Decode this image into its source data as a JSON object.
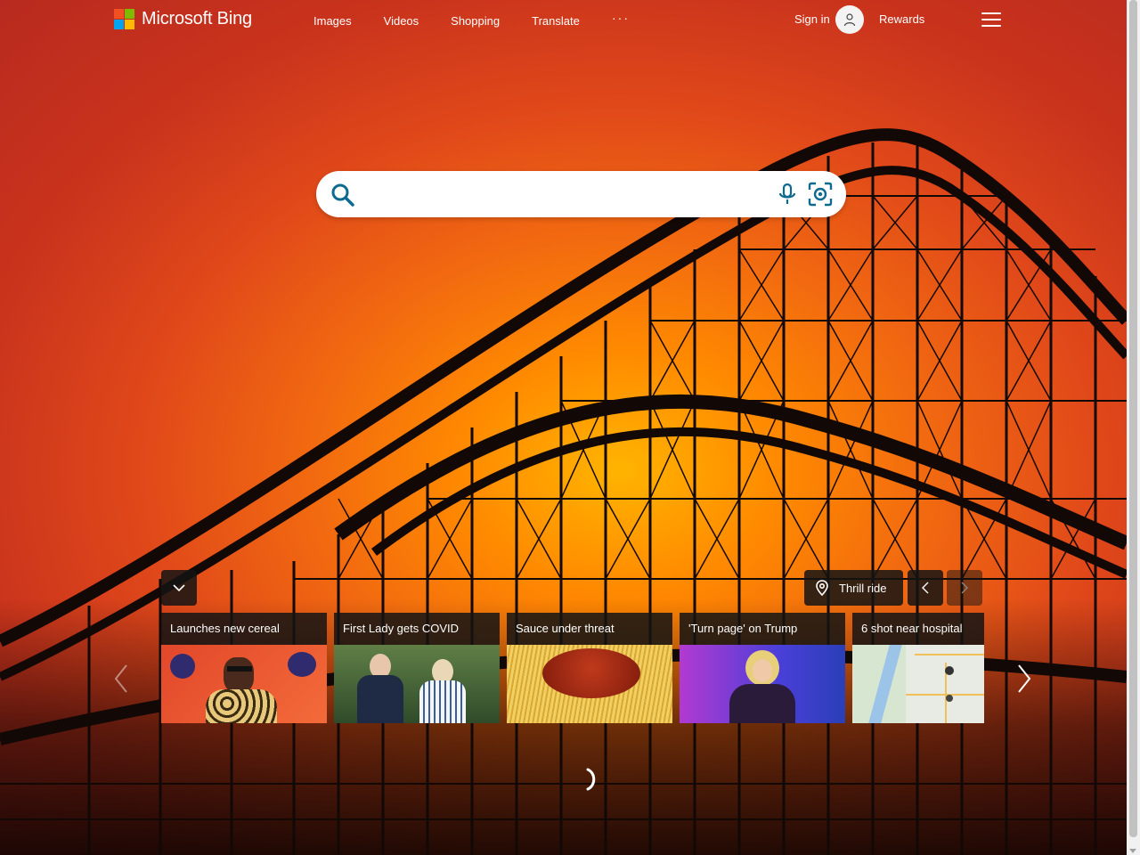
{
  "brand": {
    "name": "Microsoft Bing",
    "logo_colors": [
      "#f25022",
      "#7fba00",
      "#00a4ef",
      "#ffb900"
    ]
  },
  "nav": {
    "items": [
      {
        "label": "Images"
      },
      {
        "label": "Videos"
      },
      {
        "label": "Shopping"
      },
      {
        "label": "Translate"
      }
    ],
    "more": "···"
  },
  "account": {
    "signin_label": "Sign in",
    "rewards_label": "Rewards"
  },
  "search": {
    "value": "",
    "placeholder": "",
    "icons": [
      "search-icon",
      "microphone-icon",
      "visual-search-icon"
    ],
    "accent": "#0e6b8f"
  },
  "background": {
    "location_label": "Thrill ride"
  },
  "news": [
    {
      "title": "Launches new cereal",
      "image": "snoop-dogg-award-backdrop"
    },
    {
      "title": "First Lady gets COVID",
      "image": "biden-couple-walking"
    },
    {
      "title": "Sauce under threat",
      "image": "spaghetti-sauce"
    },
    {
      "title": "'Turn page' on Trump",
      "image": "speaker-at-podium"
    },
    {
      "title": "6 shot near hospital",
      "image": "map-memphis"
    }
  ]
}
